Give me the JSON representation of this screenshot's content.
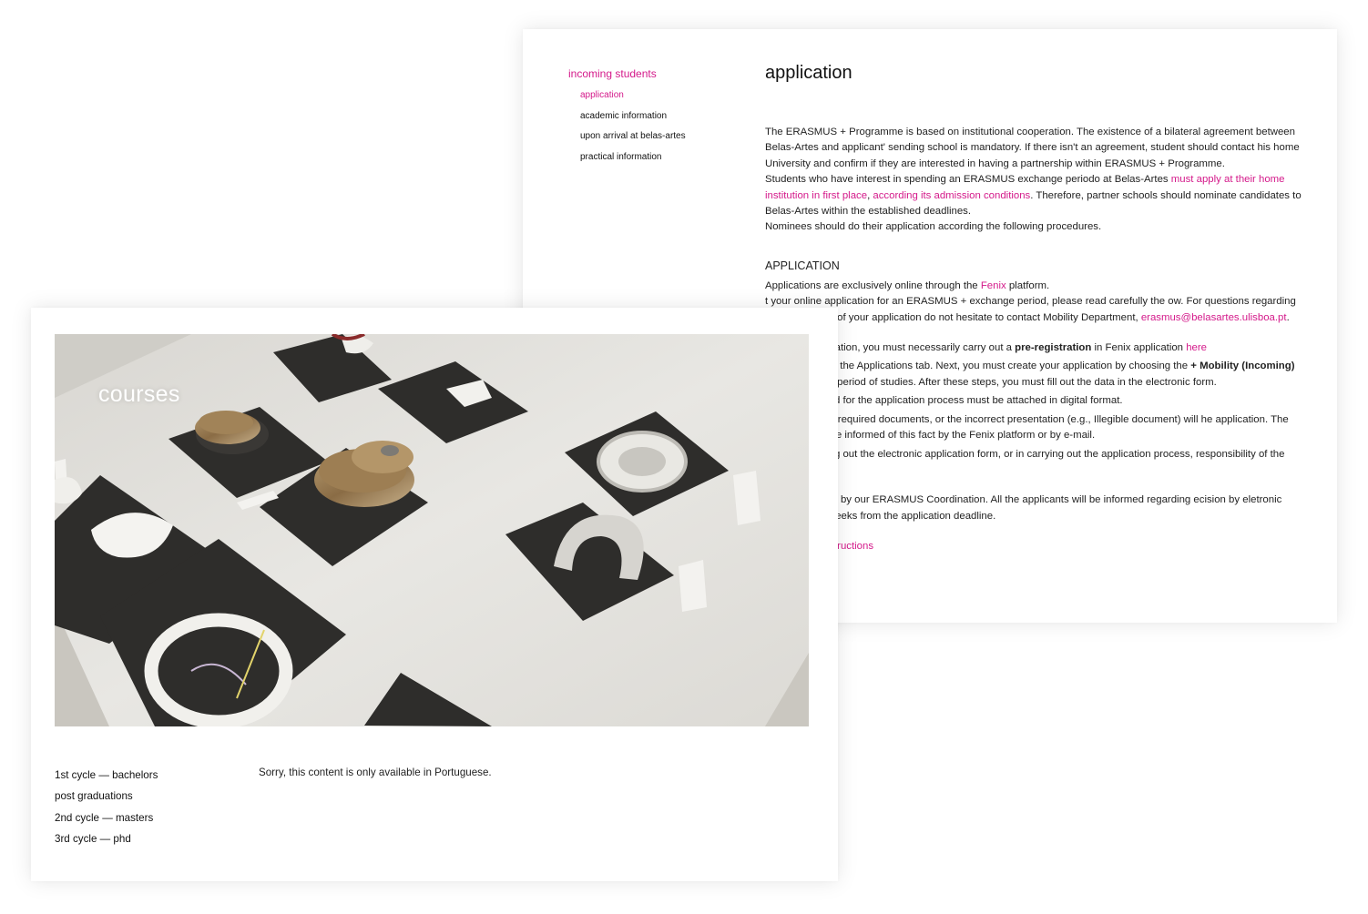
{
  "application_page": {
    "nav": {
      "parent": "incoming students",
      "items": [
        "application",
        "academic information",
        "upon arrival at belas-artes",
        "practical information"
      ]
    },
    "title": "application",
    "intro": {
      "p1": "The ERASMUS + Programme is based on institutional cooperation. The existence of a bilateral agreement between Belas-Artes and applicant' sending school is mandatory. If there isn't an agreement, student should contact his home University and confirm if they are interested in having a partnership within ERASMUS + Programme.",
      "p2_start": "Students who have interest in spending an ERASMUS exchange periodo at Belas-Artes ",
      "p2_link1": "must apply at their home institution in first place",
      "p2_sep": ", ",
      "p2_link2": "according its admission conditions",
      "p2_end": ". Therefore, partner schools should nominate candidates to Belas-Artes within the established deadlines.",
      "p3": "Nominees should do their application according the following procedures."
    },
    "section_title": "APPLICATION",
    "app_line_start": "Applications are exclusively online through the ",
    "app_line_link": "Fenix",
    "app_line_end": " platform.",
    "para_a_start": "t your online application for an ERASMUS + exchange period, please read carefully the ow. For questions regarding the submission of your application do not hesitate to contact Mobility Department, ",
    "para_a_email": "erasmus@belasartes.ulisboa.pt",
    "para_a_end": ".",
    "para_b_start": "ur online application, you must necessarily carry out a ",
    "para_b_bold1": "pre-registration",
    "para_b_mid": " in Fenix application ",
    "para_b_link": "here",
    "para_c_start": " you must select the Applications tab. Next, you must create your application by choosing the ",
    "para_c_bold": "+ Mobility (Incoming)",
    "para_c_end": " regime and the period of studies. After these steps, you must fill out the data in the electronic form.",
    "para_d": "uments required for the application process must be attached in digital format.",
    "para_e": "bmission of the required documents, or the incorrect presentation (e.g., Illegible document) will he application. The candidate will be informed of this fact by the Fenix platform or by e-mail.",
    "para_f": "nissions in filling out the electronic application form, or in carrying out the application process, responsibility of the candidate.",
    "para_g": "ll be considered by our ERASMUS Coordination. All the applicants will be informed regarding ecision by eletronic mail, within 4 weeks from the application deadline.",
    "step_link": "tep by Step Instructions"
  },
  "courses_page": {
    "hero_title": "courses",
    "nav": [
      "1st cycle — bachelors",
      "post graduations",
      "2nd cycle — masters",
      "3rd cycle — phd"
    ],
    "message": "Sorry, this content is only available in Portuguese."
  },
  "colors": {
    "accent": "#d4198a",
    "text": "#222222",
    "background": "#ffffff"
  }
}
